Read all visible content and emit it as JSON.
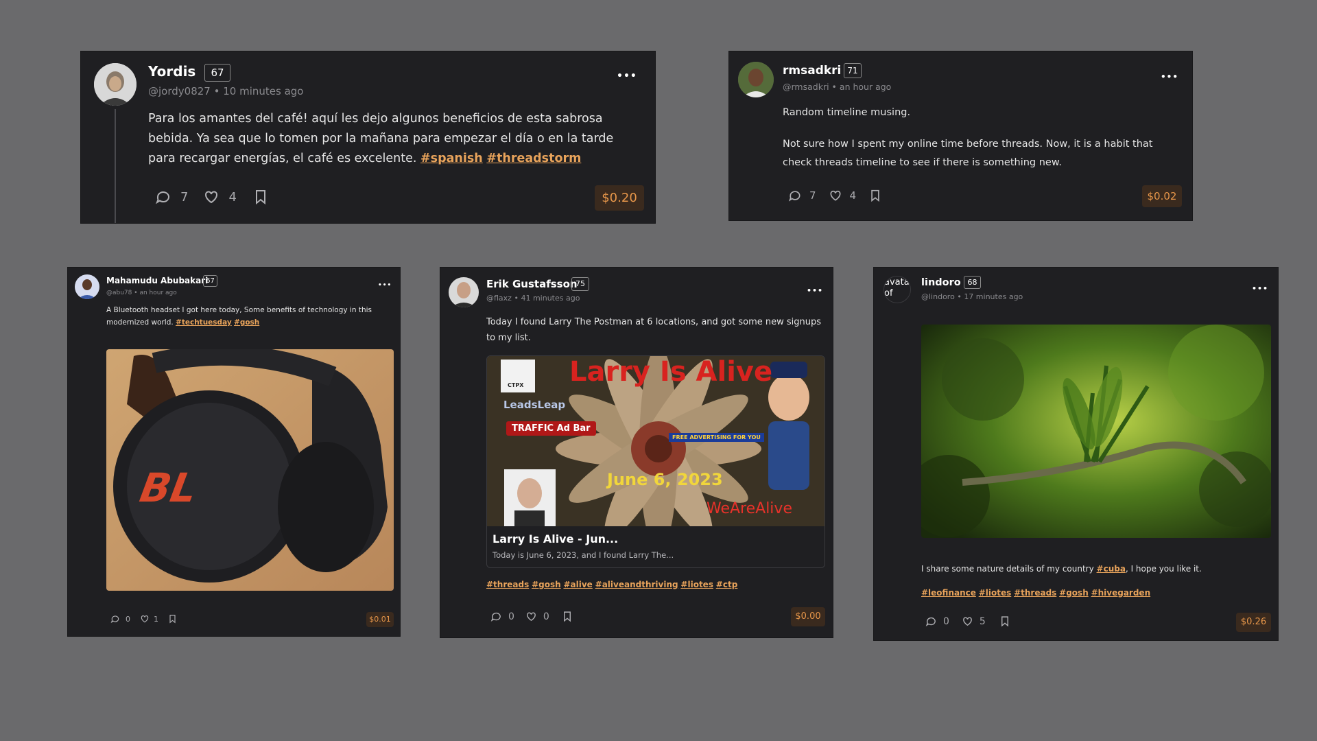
{
  "posts": [
    {
      "author": "Yordis",
      "rep": "67",
      "handle": "@jordy0827",
      "time": "10 minutes ago",
      "text": "Para los amantes del café! aquí les dejo algunos beneficios de esta sabrosa bebida. Ya sea que lo tomen por la mañana para empezar el día o en la tarde para recargar energías, el café es excelente. ",
      "tags": [
        "#spanish",
        "#threadstorm"
      ],
      "comments": "7",
      "likes": "4",
      "payout": "$0.20"
    },
    {
      "author": "rmsadkri",
      "rep": "71",
      "handle": "@rmsadkri",
      "time": "an hour ago",
      "text1": "Random timeline musing.",
      "text2": "Not sure how I spent my online time before threads. Now, it is a habit that check threads timeline to see if there is something new.",
      "comments": "7",
      "likes": "4",
      "payout": "$0.02"
    },
    {
      "author": "Mahamudu Abubakari",
      "rep": "67",
      "handle": "@abu78",
      "time": "an hour ago",
      "text": "A Bluetooth headset I got here today, Some benefits of technology in this modernized world. ",
      "tags": [
        "#techtuesday",
        "#gosh"
      ],
      "image_logo": "BL",
      "comments": "0",
      "likes": "1",
      "payout": "$0.01"
    },
    {
      "author": "Erik Gustafsson",
      "rep": "75",
      "handle": "@flaxz",
      "time": "41 minutes ago",
      "text": "Today I found Larry The Postman at 6 locations, and got some new signups to my list.",
      "preview": {
        "banner_title": "Larry Is Alive",
        "ctpx": "CTPX",
        "leadsleap": "LeadsLeap",
        "traffic": "TRAFFIC Ad Bar",
        "date": "June 6, 2023",
        "wearealive": "WeAreAlive",
        "free_ad": "FREE ADVERTISING FOR YOU",
        "title": "Larry Is Alive - Jun...",
        "desc": "Today is June 6, 2023, and I found Larry The..."
      },
      "tags": [
        "#threads",
        "#gosh",
        "#alive",
        "#aliveandthriving",
        "#liotes",
        "#ctp"
      ],
      "comments": "0",
      "likes": "0",
      "payout": "$0.00"
    },
    {
      "author": "lindoro",
      "rep": "68",
      "handle": "@lindoro",
      "time": "17 minutes ago",
      "avatar_alt": "avata of",
      "text": "I share some nature details of my country ",
      "inline_tag": "#cuba",
      "text_end": ", I hope you like it.",
      "tags": [
        "#leofinance",
        "#liotes",
        "#threads",
        "#gosh",
        "#hivegarden"
      ],
      "comments": "0",
      "likes": "5",
      "payout": "$0.26"
    }
  ],
  "meta_sep": "•",
  "more": "•••",
  "icons": [
    "comment-icon",
    "heart-icon",
    "bookmark-icon",
    "more-icon"
  ],
  "colors": {
    "background": "#6a6a6c",
    "card": "#1f1f22",
    "tag": "#e8a35b",
    "payout": "#e8974a"
  }
}
